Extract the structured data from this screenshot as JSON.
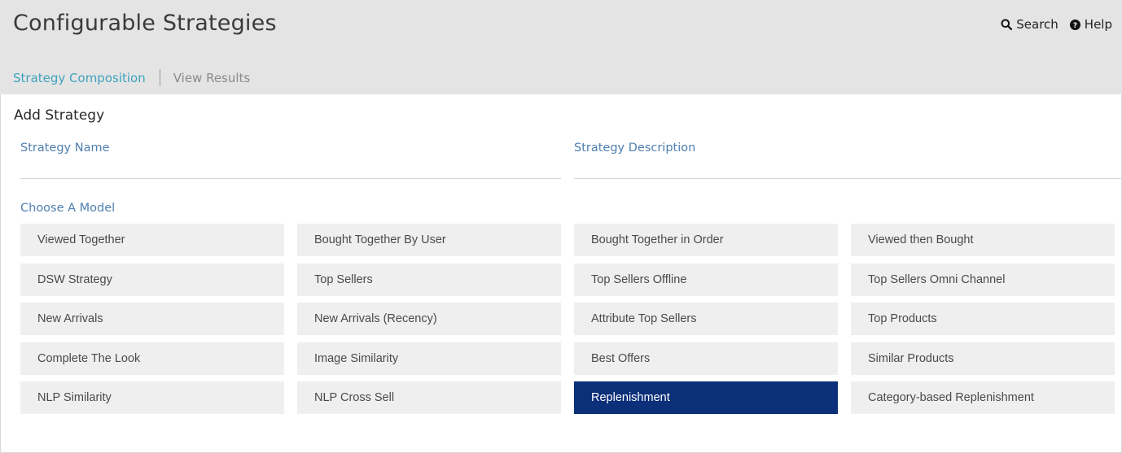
{
  "header": {
    "title": "Configurable Strategies",
    "search_label": "Search",
    "help_label": "Help",
    "search_icon": "search-icon",
    "help_icon": "question-circle-icon"
  },
  "tabs": [
    {
      "label": "Strategy Composition",
      "active": true
    },
    {
      "label": "View Results",
      "active": false
    }
  ],
  "form": {
    "section_title": "Add Strategy",
    "name_label": "Strategy Name",
    "name_value": "",
    "description_label": "Strategy Description",
    "description_value": "",
    "model_label": "Choose A Model"
  },
  "models": [
    "Viewed Together",
    "Bought Together By User",
    "Bought Together in Order",
    "Viewed then Bought",
    "DSW Strategy",
    "Top Sellers",
    "Top Sellers Offline",
    "Top Sellers Omni Channel",
    "New Arrivals",
    "New Arrivals (Recency)",
    "Attribute Top Sellers",
    "Top Products",
    "Complete The Look",
    "Image Similarity",
    "Best Offers",
    "Similar Products",
    "NLP Similarity",
    "NLP Cross Sell",
    "Replenishment",
    "Category-based Replenishment"
  ],
  "selected_model": "Replenishment",
  "colors": {
    "header_bg": "#e4e4e4",
    "active_tab": "#3ea3be",
    "label_blue": "#4f7fb0",
    "selected_bg": "#0b2f78",
    "button_bg": "#efefef"
  }
}
